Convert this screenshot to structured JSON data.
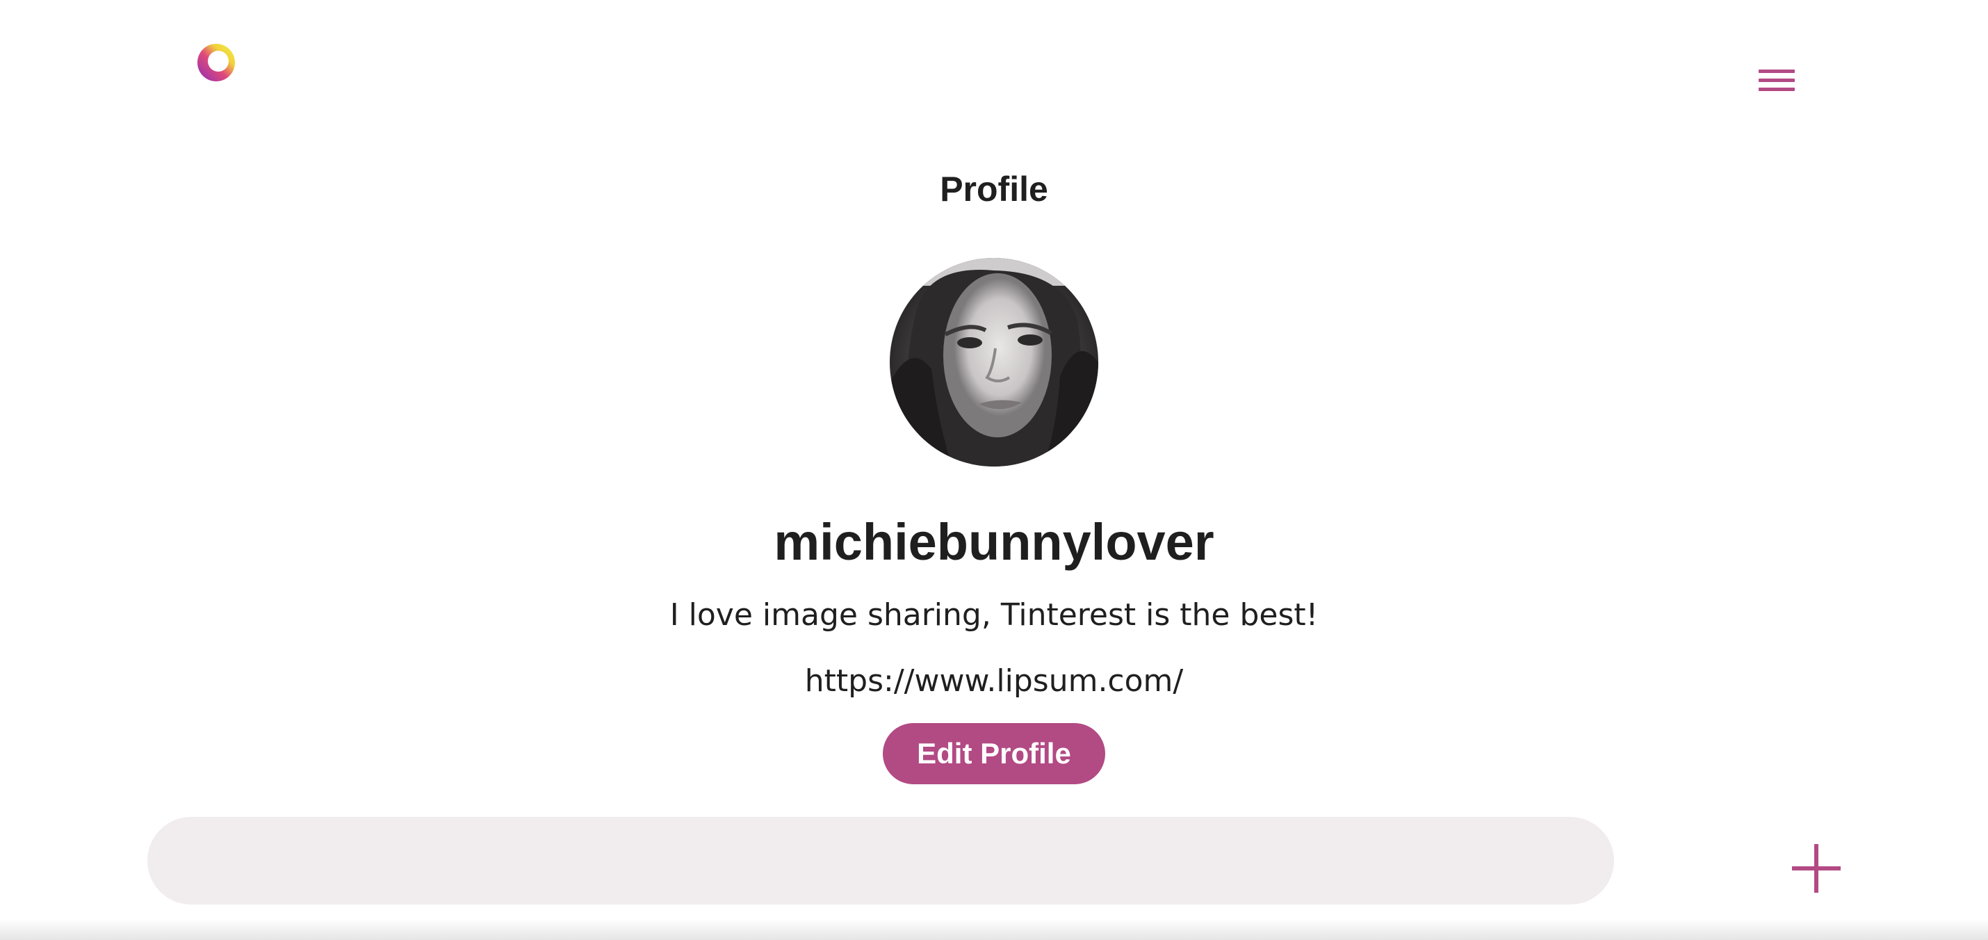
{
  "header": {
    "logo_icon": "ring-logo-icon",
    "menu_icon": "hamburger-menu-icon"
  },
  "page": {
    "title": "Profile"
  },
  "profile": {
    "avatar_icon": "profile-photo",
    "username": "michiebunnylover",
    "bio": "I love image sharing, Tinterest is the best!",
    "website": "https://www.lipsum.com/",
    "edit_label": "Edit Profile"
  },
  "search": {
    "placeholder": "",
    "value": ""
  },
  "fab": {
    "icon": "plus-icon"
  },
  "colors": {
    "accent": "#b24a84",
    "search_bg": "#f1eced",
    "text": "#1f1f1f"
  }
}
